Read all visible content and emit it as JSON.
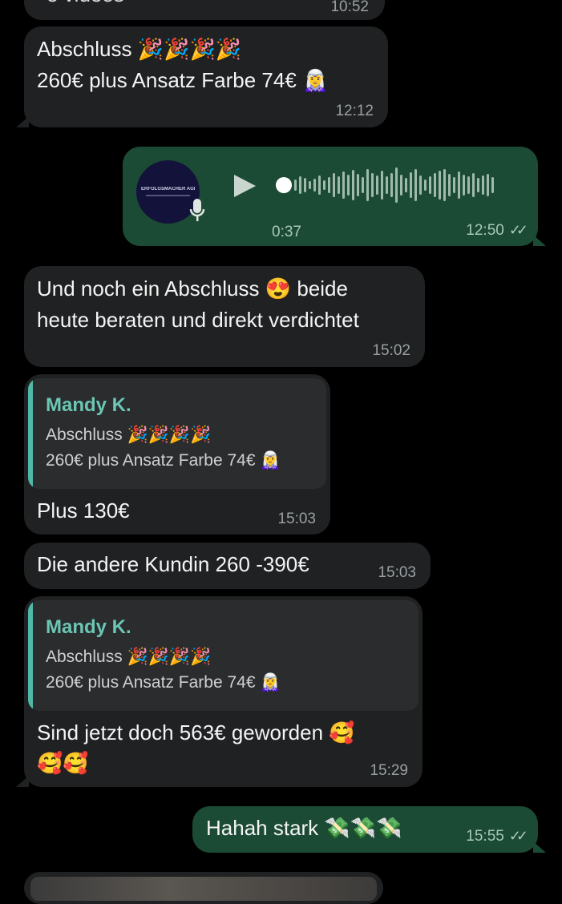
{
  "top_partial": {
    "text": "e videos",
    "time": "10:52"
  },
  "msg1": {
    "line1": "Abschluss 🎉🎉🎉🎉",
    "line2": "260€ plus Ansatz Farbe 74€ 🧝‍♀️",
    "time": "12:12"
  },
  "voice": {
    "duration": "0:37",
    "time": "12:50",
    "ticks": "✓✓",
    "avatar_text": "ERFOLGSMACHER AGENCY",
    "progress": 0.0
  },
  "msg2": {
    "line1": "Und noch ein Abschluss 😍 beide",
    "line2": "heute beraten und direkt verdichtet",
    "time": "15:02"
  },
  "msg3": {
    "quote_name": "Mandy K.",
    "quote_line1": "Abschluss 🎉🎉🎉🎉",
    "quote_line2": "260€ plus Ansatz Farbe 74€ 🧝‍♀️",
    "text": "Plus 130€",
    "time": "15:03"
  },
  "msg4": {
    "text": "Die andere Kundin 260 -390€",
    "time": "15:03"
  },
  "msg5": {
    "quote_name": "Mandy K.",
    "quote_line1": "Abschluss 🎉🎉🎉🎉",
    "quote_line2": "260€ plus Ansatz Farbe 74€ 🧝‍♀️",
    "line1": "Sind jetzt doch 563€ geworden 🥰",
    "line2": "🥰🥰",
    "time": "15:29"
  },
  "msg6": {
    "text": "Hahah stark 💸💸💸",
    "time": "15:55",
    "ticks": "✓✓"
  },
  "colors": {
    "incoming": "#1f2122",
    "outgoing": "#1c4b35",
    "quote_accent": "#4fb8a6",
    "background": "#000000"
  }
}
